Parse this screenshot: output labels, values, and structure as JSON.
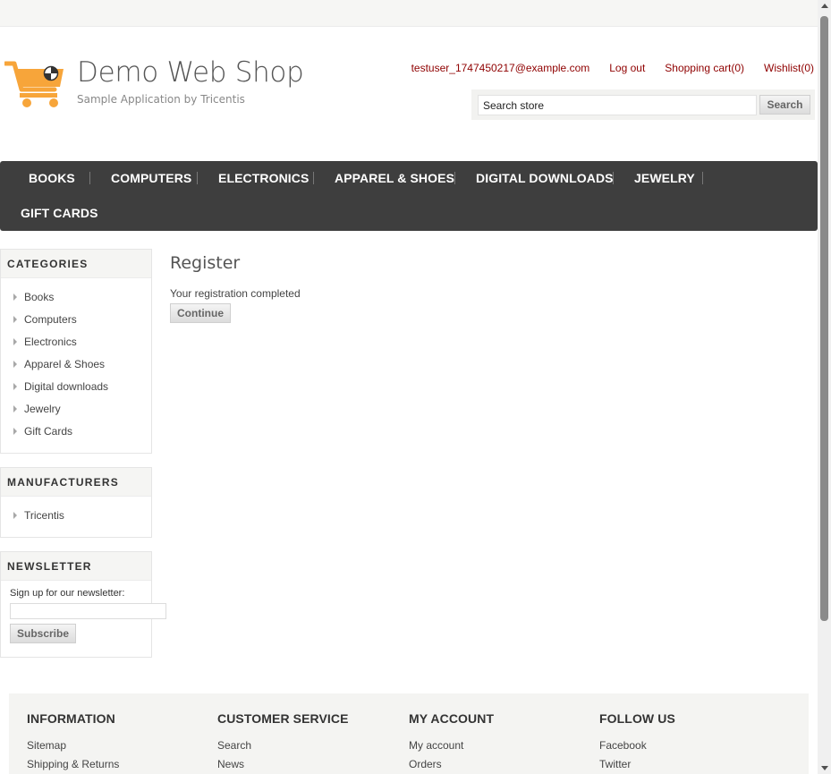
{
  "header": {
    "title": "Demo Web Shop",
    "subtitle": "Sample Application by Tricentis",
    "links": {
      "account": "testuser_1747450217@example.com",
      "logout": "Log out",
      "cart": "Shopping cart(0)",
      "wishlist": "Wishlist(0)"
    },
    "search": {
      "value": "Search store",
      "button": "Search"
    },
    "logo_icon": "shopping-cart-logo-icon",
    "accent_color": "#f7a53a"
  },
  "menu": [
    "BOOKS",
    "COMPUTERS",
    "ELECTRONICS",
    "APPAREL & SHOES",
    "DIGITAL DOWNLOADS",
    "JEWELRY",
    "GIFT CARDS"
  ],
  "sidebar": {
    "categories": {
      "title": "CATEGORIES",
      "items": [
        "Books",
        "Computers",
        "Electronics",
        "Apparel & Shoes",
        "Digital downloads",
        "Jewelry",
        "Gift Cards"
      ]
    },
    "manufacturers": {
      "title": "MANUFACTURERS",
      "items": [
        "Tricentis"
      ]
    },
    "newsletter": {
      "title": "NEWSLETTER",
      "label": "Sign up for our newsletter:",
      "button": "Subscribe"
    }
  },
  "main": {
    "title": "Register",
    "result": "Your registration completed",
    "continue": "Continue"
  },
  "footer": {
    "information": {
      "title": "INFORMATION",
      "links": [
        "Sitemap",
        "Shipping & Returns"
      ]
    },
    "customer_service": {
      "title": "CUSTOMER SERVICE",
      "links": [
        "Search",
        "News"
      ]
    },
    "my_account": {
      "title": "MY ACCOUNT",
      "links": [
        "My account",
        "Orders"
      ]
    },
    "follow_us": {
      "title": "FOLLOW US",
      "links": [
        "Facebook",
        "Twitter"
      ]
    }
  },
  "colors": {
    "link": "#8f0000",
    "menu_bg": "#3e3e3e"
  }
}
